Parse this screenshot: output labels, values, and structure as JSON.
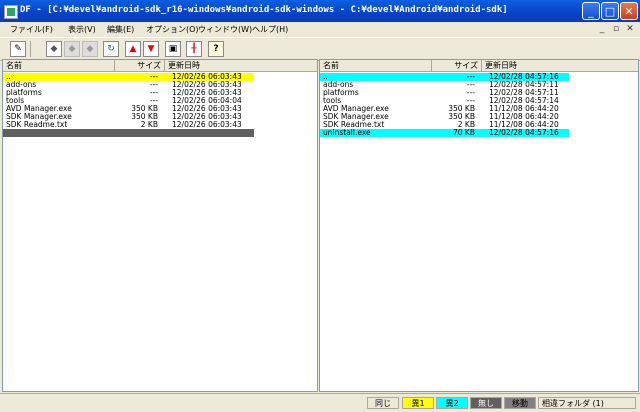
{
  "window": {
    "title": "DF - [C:¥devel¥android-sdk_r16-windows¥android-sdk-windows  -  C:¥devel¥Android¥android-sdk]",
    "minimize": "_",
    "maximize": "□",
    "close": "✕"
  },
  "menu": {
    "items": [
      "ファイル(F)",
      "表示(V)",
      "編集(E)",
      "オプション(O)",
      "ウィンドウ(W)",
      "ヘルプ(H)"
    ],
    "mdi_min": "_",
    "mdi_restore": "▫",
    "mdi_close": "✕"
  },
  "toolbar": {
    "buttons": [
      {
        "icon": "edit-icon",
        "glyph": "✎",
        "enabled": true
      },
      {
        "icon": "copy-left-icon",
        "glyph": "◆",
        "enabled": true
      },
      {
        "icon": "copy-right-icon",
        "glyph": "◆",
        "enabled": false
      },
      {
        "icon": "copy-all-icon",
        "glyph": "◆",
        "enabled": false
      },
      {
        "icon": "refresh-icon",
        "glyph": "↻",
        "enabled": true
      },
      {
        "icon": "diff-up-icon",
        "glyph": "▲",
        "enabled": true
      },
      {
        "icon": "diff-down-icon",
        "glyph": "▼",
        "enabled": true
      },
      {
        "icon": "window-icon",
        "glyph": "▣",
        "enabled": true
      },
      {
        "icon": "split-icon",
        "glyph": "╫",
        "enabled": true
      },
      {
        "icon": "help-icon",
        "glyph": "?",
        "enabled": true
      }
    ]
  },
  "columns": {
    "name": "名前",
    "size": "サイズ",
    "date": "更新日時"
  },
  "left_pane": {
    "rows": [
      {
        "name": "..",
        "size": "---",
        "date": "12/02/26 06:03:43",
        "highlight": "#ffff00"
      },
      {
        "name": "add-ons",
        "size": "---",
        "date": "12/02/26 06:03:43",
        "highlight": ""
      },
      {
        "name": "platforms",
        "size": "---",
        "date": "12/02/26 06:03:43",
        "highlight": ""
      },
      {
        "name": "tools",
        "size": "---",
        "date": "12/02/26 06:04:04",
        "highlight": ""
      },
      {
        "name": "AVD Manager.exe",
        "size": "350 KB",
        "date": "12/02/26 06:03:43",
        "highlight": ""
      },
      {
        "name": "SDK Manager.exe",
        "size": "350 KB",
        "date": "12/02/26 06:03:43",
        "highlight": ""
      },
      {
        "name": "SDK Readme.txt",
        "size": "2 KB",
        "date": "12/02/26 06:03:43",
        "highlight": ""
      },
      {
        "name": "",
        "size": "",
        "date": "",
        "highlight": "#606060"
      }
    ]
  },
  "right_pane": {
    "rows": [
      {
        "name": "..",
        "size": "---",
        "date": "12/02/28 04:57:16",
        "highlight": "#00ffff"
      },
      {
        "name": "add-ons",
        "size": "---",
        "date": "12/02/28 04:57:11",
        "highlight": ""
      },
      {
        "name": "platforms",
        "size": "---",
        "date": "12/02/28 04:57:11",
        "highlight": ""
      },
      {
        "name": "tools",
        "size": "---",
        "date": "12/02/28 04:57:14",
        "highlight": ""
      },
      {
        "name": "AVD Manager.exe",
        "size": "350 KB",
        "date": "11/12/08 06:44:20",
        "highlight": ""
      },
      {
        "name": "SDK Manager.exe",
        "size": "350 KB",
        "date": "11/12/08 06:44:20",
        "highlight": ""
      },
      {
        "name": "SDK Readme.txt",
        "size": "2 KB",
        "date": "11/12/08 06:44:20",
        "highlight": ""
      },
      {
        "name": "uninstall.exe",
        "size": "70 KB",
        "date": "12/02/28 04:57:16",
        "highlight": "#00ffff"
      }
    ]
  },
  "status": {
    "items": [
      {
        "label": "同じ",
        "bg": "#ece9d8",
        "color": "#000000"
      },
      {
        "label": "異1",
        "bg": "#ffff00",
        "color": "#000000"
      },
      {
        "label": "異2",
        "bg": "#00ffff",
        "color": "#000000"
      },
      {
        "label": "無し",
        "bg": "#606060",
        "color": "#ffffff"
      },
      {
        "label": "移動",
        "bg": "#808080",
        "color": "#000000"
      },
      {
        "label": "相違フォルダ (1)",
        "bg": "#ece9d8",
        "color": "#000000"
      }
    ]
  }
}
